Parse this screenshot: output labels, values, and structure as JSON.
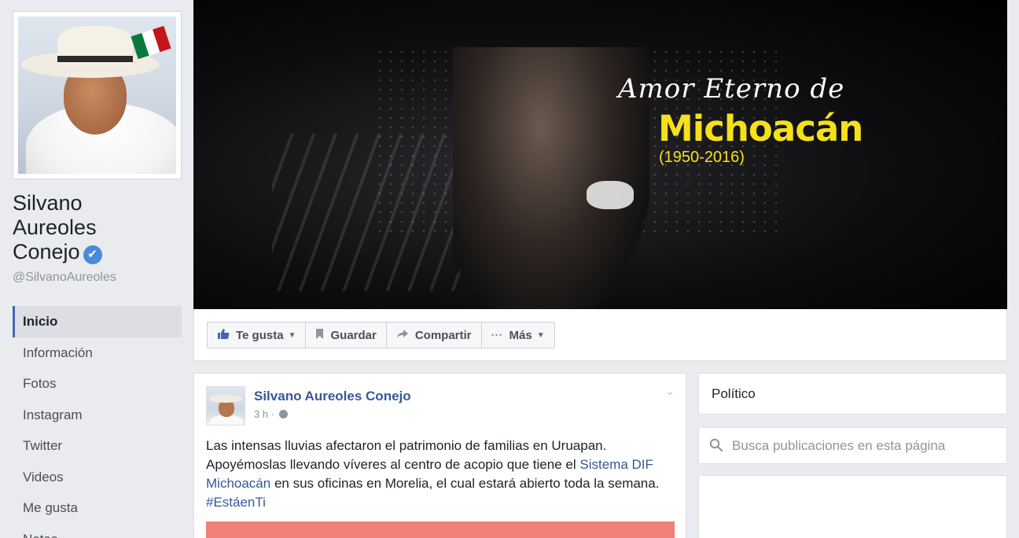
{
  "profile": {
    "name_line1": "Silvano",
    "name_line2": "Aureoles",
    "name_line3": "Conejo",
    "username": "@SilvanoAureoles",
    "verified_icon": "✔"
  },
  "side_nav": {
    "items": [
      {
        "label": "Inicio",
        "active": true
      },
      {
        "label": "Información"
      },
      {
        "label": "Fotos"
      },
      {
        "label": "Instagram"
      },
      {
        "label": "Twitter"
      },
      {
        "label": "Videos"
      },
      {
        "label": "Me gusta"
      },
      {
        "label": "Notas"
      }
    ]
  },
  "cover": {
    "title": "Amor Eterno de",
    "subtitle": "Michoacán",
    "years": "(1950-2016)"
  },
  "actions": {
    "like": "Te gusta",
    "save": "Guardar",
    "share": "Compartir",
    "more": "Más"
  },
  "post": {
    "author": "Silvano Aureoles Conejo",
    "time": "3 h",
    "meta_sep": "·",
    "text_part1": "Las intensas lluvias afectaron el patrimonio de familias en Uruapan. Apoyémoslas llevando víveres al centro de acopio que tiene el ",
    "link1": "Sistema DIF Michoacán",
    "text_part2": " en sus oficinas en Morelia, el cual estará abierto toda la semana. ",
    "hashtag": "#EstáenTi"
  },
  "right": {
    "category": "Político",
    "search_placeholder": "Busca publicaciones en esta página"
  },
  "colors": {
    "link": "#365899",
    "accent": "#4267b2",
    "background": "#e9ebee",
    "cover_highlight": "#f5e01c",
    "post_image": "#f08078"
  },
  "icons": {
    "like": "thumbs-up-icon",
    "save": "bookmark-icon",
    "share": "share-arrow-icon",
    "more": "ellipsis-icon",
    "search": "search-icon",
    "privacy": "globe-icon",
    "menu": "chevron-down-icon"
  }
}
